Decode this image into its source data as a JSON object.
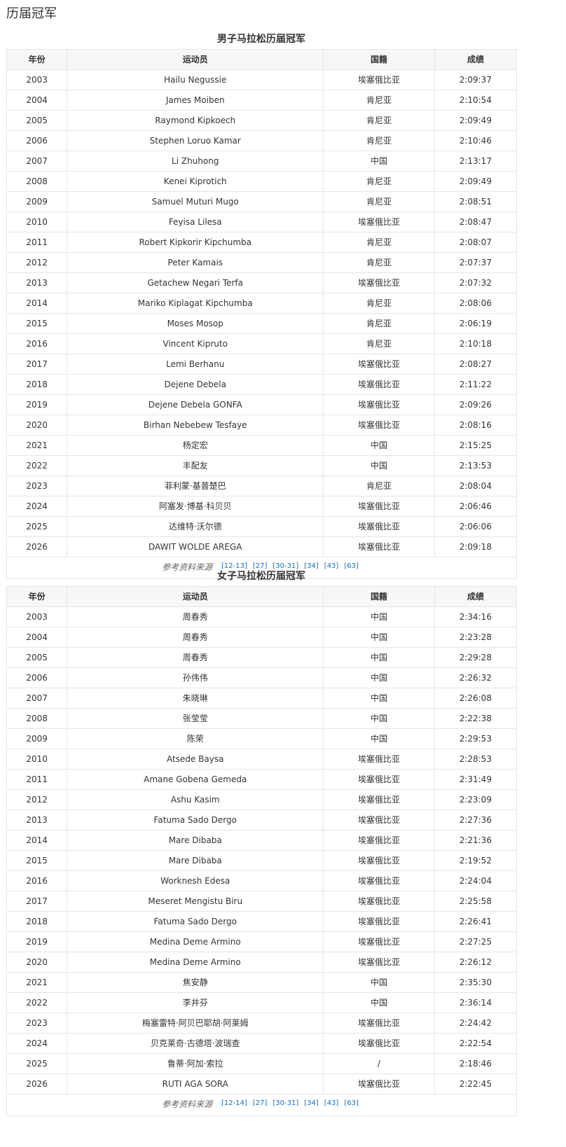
{
  "page_title": "历届冠军",
  "headers": {
    "year": "年份",
    "athlete": "运动员",
    "nation": "国籍",
    "time": "成绩"
  },
  "tables": [
    {
      "caption": "男子马拉松历届冠军",
      "rows": [
        [
          "2003",
          "Hailu Negussie",
          "埃塞俄比亚",
          "2:09:37"
        ],
        [
          "2004",
          "James Moiben",
          "肯尼亚",
          "2:10:54"
        ],
        [
          "2005",
          "Raymond Kipkoech",
          "肯尼亚",
          "2:09:49"
        ],
        [
          "2006",
          "Stephen Loruo Kamar",
          "肯尼亚",
          "2:10:46"
        ],
        [
          "2007",
          "Li Zhuhong",
          "中国",
          "2:13:17"
        ],
        [
          "2008",
          "Kenei Kiprotich",
          "肯尼亚",
          "2:09:49"
        ],
        [
          "2009",
          "Samuel Muturi Mugo",
          "肯尼亚",
          "2:08:51"
        ],
        [
          "2010",
          "Feyisa Lilesa",
          "埃塞俄比亚",
          "2:08:47"
        ],
        [
          "2011",
          "Robert Kipkorir Kipchumba",
          "肯尼亚",
          "2:08:07"
        ],
        [
          "2012",
          "Peter Kamais",
          "肯尼亚",
          "2:07:37"
        ],
        [
          "2013",
          "Getachew Negari Terfa",
          "埃塞俄比亚",
          "2:07:32"
        ],
        [
          "2014",
          "Mariko Kiplagat Kipchumba",
          "肯尼亚",
          "2:08:06"
        ],
        [
          "2015",
          "Moses Mosop",
          "肯尼亚",
          "2:06:19"
        ],
        [
          "2016",
          "Vincent Kipruto",
          "肯尼亚",
          "2:10:18"
        ],
        [
          "2017",
          "Lemi Berhanu",
          "埃塞俄比亚",
          "2:08:27"
        ],
        [
          "2018",
          "Dejene Debela",
          "埃塞俄比亚",
          "2:11:22"
        ],
        [
          "2019",
          "Dejene Debela GONFA",
          "埃塞俄比亚",
          "2:09:26"
        ],
        [
          "2020",
          "Birhan Nebebew Tesfaye",
          "埃塞俄比亚",
          "2:08:16"
        ],
        [
          "2021",
          "杨定宏",
          "中国",
          "2:15:25"
        ],
        [
          "2022",
          "丰配友",
          "中国",
          "2:13:53"
        ],
        [
          "2023",
          "菲利蒙·基普楚巴",
          "肯尼亚",
          "2:08:04"
        ],
        [
          "2024",
          "阿塞发·博基·科贝贝",
          "埃塞俄比亚",
          "2:06:46"
        ],
        [
          "2025",
          "达维特·沃尔德",
          "埃塞俄比亚",
          "2:06:06"
        ],
        [
          "2026",
          "DAWIT WOLDE AREGA",
          "埃塞俄比亚",
          "2:09:18"
        ]
      ],
      "source_label": "参考资料来源",
      "refs": [
        "[12-13]",
        "[27]",
        "[30-31]",
        "[34]",
        "[43]",
        "[63]"
      ]
    },
    {
      "caption": "女子马拉松历届冠军",
      "rows": [
        [
          "2003",
          "周春秀",
          "中国",
          "2:34:16"
        ],
        [
          "2004",
          "周春秀",
          "中国",
          "2:23:28"
        ],
        [
          "2005",
          "周春秀",
          "中国",
          "2:29:28"
        ],
        [
          "2006",
          "孙伟伟",
          "中国",
          "2:26:32"
        ],
        [
          "2007",
          "朱晓琳",
          "中国",
          "2:26:08"
        ],
        [
          "2008",
          "张莹莹",
          "中国",
          "2:22:38"
        ],
        [
          "2009",
          "陈荣",
          "中国",
          "2:29:53"
        ],
        [
          "2010",
          "Atsede Baysa",
          "埃塞俄比亚",
          "2:28:53"
        ],
        [
          "2011",
          "Amane Gobena Gemeda",
          "埃塞俄比亚",
          "2:31:49"
        ],
        [
          "2012",
          "Ashu Kasim",
          "埃塞俄比亚",
          "2:23:09"
        ],
        [
          "2013",
          "Fatuma Sado Dergo",
          "埃塞俄比亚",
          "2:27:36"
        ],
        [
          "2014",
          "Mare Dibaba",
          "埃塞俄比亚",
          "2:21:36"
        ],
        [
          "2015",
          "Mare Dibaba",
          "埃塞俄比亚",
          "2:19:52"
        ],
        [
          "2016",
          "Worknesh Edesa",
          "埃塞俄比亚",
          "2:24:04"
        ],
        [
          "2017",
          "Meseret Mengistu Biru",
          "埃塞俄比亚",
          "2:25:58"
        ],
        [
          "2018",
          "Fatuma Sado Dergo",
          "埃塞俄比亚",
          "2:26:41"
        ],
        [
          "2019",
          "Medina Deme Armino",
          "埃塞俄比亚",
          "2:27:25"
        ],
        [
          "2020",
          "Medina Deme Armino",
          "埃塞俄比亚",
          "2:26:12"
        ],
        [
          "2021",
          "焦安静",
          "中国",
          "2:35:30"
        ],
        [
          "2022",
          "李井芬",
          "中国",
          "2:36:14"
        ],
        [
          "2023",
          "梅塞雷特·阿贝巴耶胡·阿莱姆",
          "埃塞俄比亚",
          "2:24:42"
        ],
        [
          "2024",
          "贝克莱奇·古德塔·波瑞查",
          "埃塞俄比亚",
          "2:22:54"
        ],
        [
          "2025",
          "鲁蒂·阿加·索拉",
          "/",
          "2:18:46"
        ],
        [
          "2026",
          "RUTI AGA SORA",
          "埃塞俄比亚",
          "2:22:45"
        ]
      ],
      "source_label": "参考资料来源",
      "refs": [
        "[12-14]",
        "[27]",
        "[30-31]",
        "[34]",
        "[43]",
        "[63]"
      ]
    }
  ]
}
